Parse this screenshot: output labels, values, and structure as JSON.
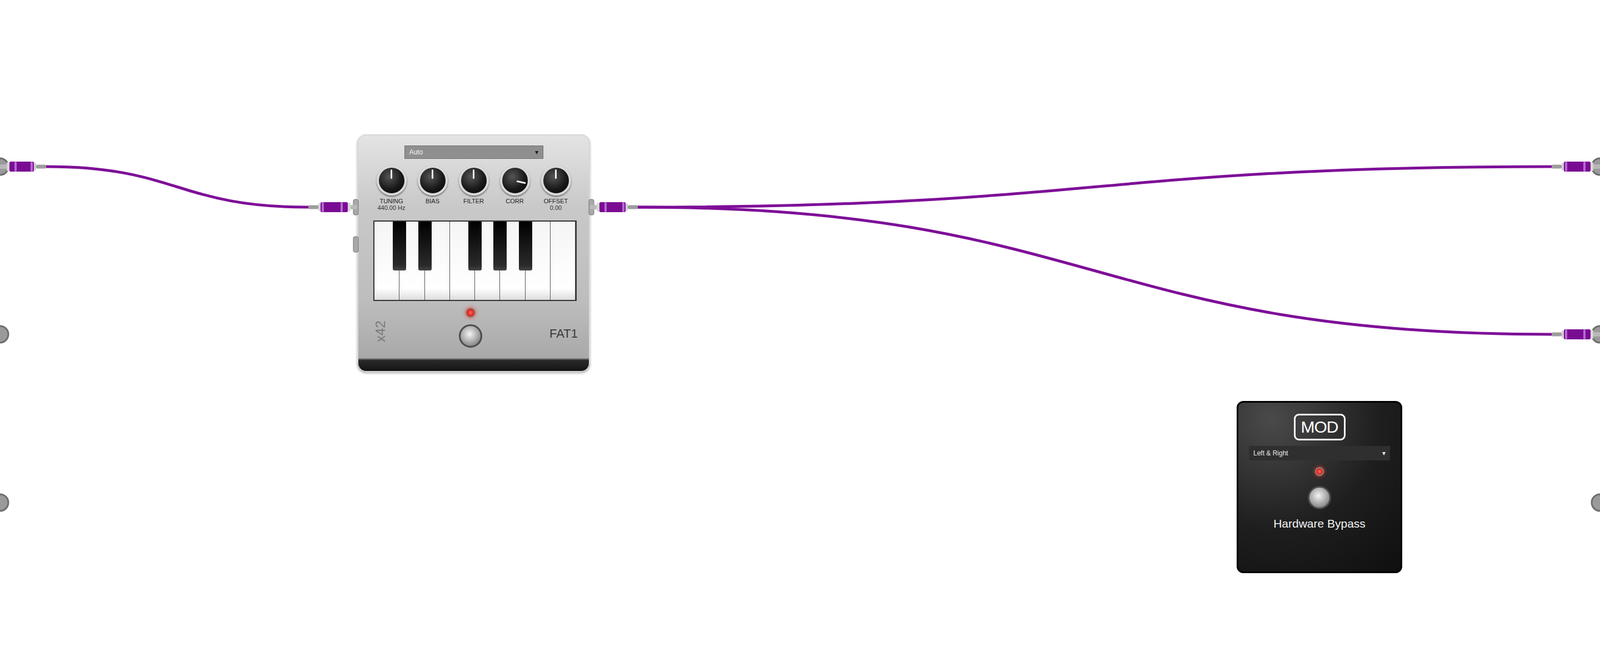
{
  "system_inputs": [
    {
      "connected": true
    },
    {
      "connected": false
    },
    {
      "connected": false
    }
  ],
  "system_outputs": [
    {
      "connected": true
    },
    {
      "connected": true
    },
    {
      "connected": false
    }
  ],
  "plugins": [
    {
      "name": "FAT1",
      "brand": "x42",
      "preset": {
        "value": "Auto",
        "arrow": "▾"
      },
      "enabled": true,
      "inputs": [
        {
          "connected": true
        },
        {
          "connected": false
        }
      ],
      "outputs": [
        {
          "connected": true
        }
      ],
      "knobs": [
        {
          "label": "TUNING",
          "reading": "440.00 Hz",
          "level": 0.5
        },
        {
          "label": "BIAS",
          "level": 0.5
        },
        {
          "label": "FILTER",
          "level": 0.5
        },
        {
          "label": "CORR",
          "level": 0.88
        },
        {
          "label": "OFFSET",
          "reading": "0.00",
          "level": 0.5
        }
      ]
    }
  ],
  "bypass": {
    "logo": "MOD",
    "mode": {
      "value": "Left & Right",
      "arrow": "▾"
    },
    "enabled": true,
    "label": "Hardware Bypass"
  },
  "cables": [
    {
      "from": [
        "system_input",
        0
      ],
      "to": [
        "plugin_input",
        0
      ]
    },
    {
      "from": [
        "plugin_output",
        0
      ],
      "to": [
        "system_output",
        0
      ]
    },
    {
      "from": [
        "plugin_output",
        0
      ],
      "to": [
        "system_output",
        1
      ]
    }
  ]
}
